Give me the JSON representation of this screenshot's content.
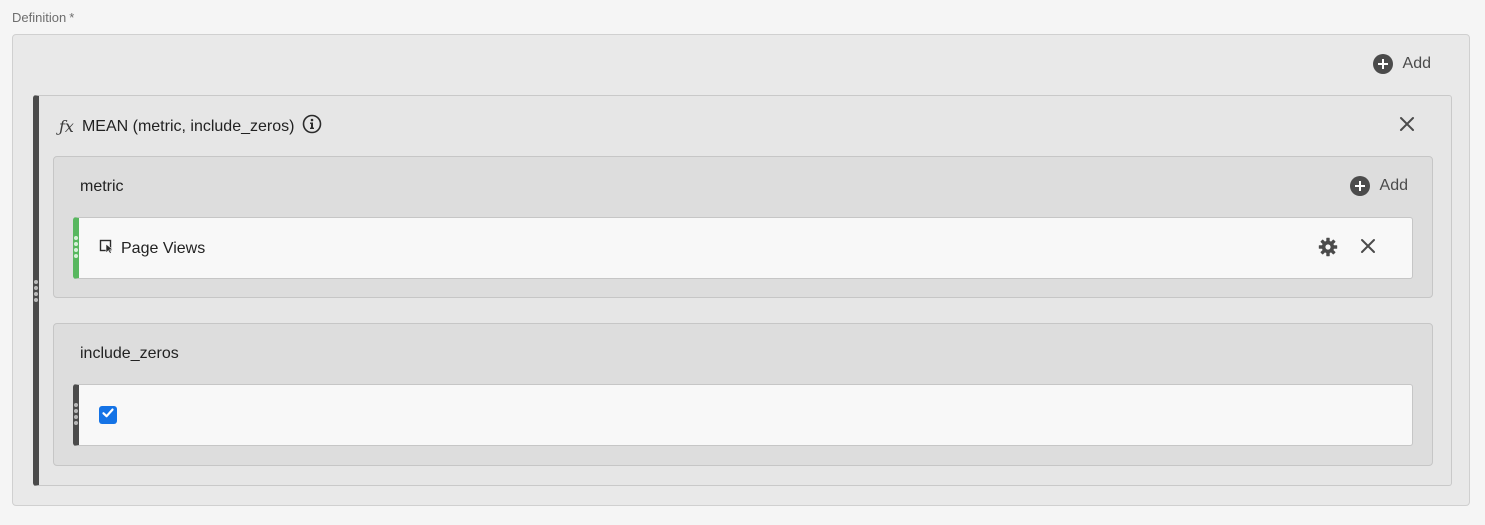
{
  "definition": {
    "label": "Definition",
    "required_mark": "*",
    "add_label": "Add"
  },
  "function": {
    "icon": "fx-icon",
    "signature": "MEAN (metric, include_zeros)",
    "info_icon": "info-icon",
    "close_icon": "close-icon"
  },
  "arguments": {
    "metric": {
      "label": "metric",
      "add_label": "Add",
      "item": {
        "icon": "metric-icon",
        "label": "Page Views",
        "accent_color": "#58b75f"
      }
    },
    "include_zeros": {
      "label": "include_zeros",
      "checked": true,
      "checkbox_color": "#1473e6"
    }
  }
}
